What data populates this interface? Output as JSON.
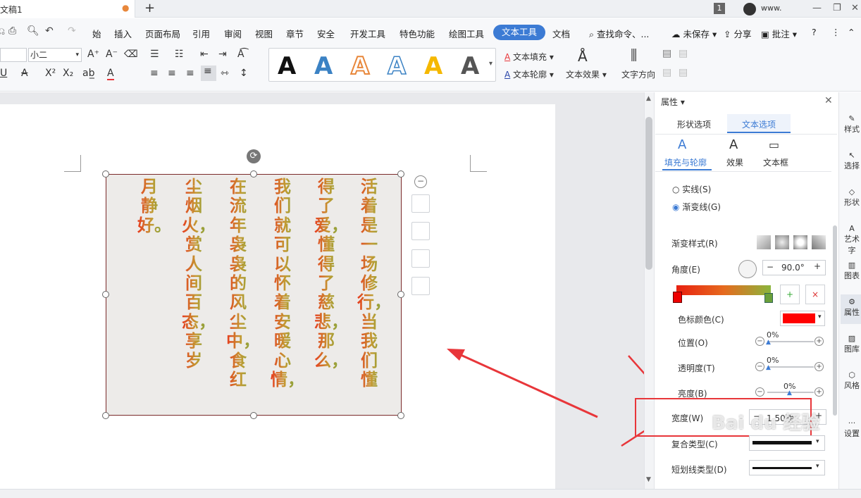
{
  "title_bar": {
    "doc_tab": "文稿1",
    "page_badge": "1",
    "user": "www."
  },
  "menu": {
    "items": [
      "插入",
      "页面布局",
      "引用",
      "审阅",
      "视图",
      "章节",
      "安全",
      "开发工具",
      "特色功能",
      "绘图工具"
    ],
    "active": "文本工具",
    "trailing": "文档",
    "search": "查找命令、...",
    "unsaved": "未保存",
    "share": "分享",
    "comment": "批注"
  },
  "toolbar": {
    "font_size": "小二",
    "text_fill": "文本填充",
    "text_outline": "文本轮廓",
    "text_effect": "文本效果",
    "text_direction": "文字方向",
    "style_colors": [
      "#111111",
      "#3b82c4",
      "#e8873b",
      "#3b82c4",
      "#f5b800",
      "#555555"
    ]
  },
  "document": {
    "columns": [
      "活着是一场修行，当我们懂",
      "得了爱，懂得了慈悲，那么，",
      "我们就可以怀着安暖心情，",
      "在流年袅袅的风尘中，食红",
      "尘烟火，赏人间百态，享岁",
      "月静好。"
    ]
  },
  "panel": {
    "title": "属性",
    "tabs": [
      "形状选项",
      "文本选项"
    ],
    "active_tab": "文本选项",
    "subtabs": [
      "填充与轮廓",
      "效果",
      "文本框"
    ],
    "line_solid": "实线(S)",
    "line_gradient": "渐变线(G)",
    "gradient_style": "渐变样式(R)",
    "angle_label": "角度(E)",
    "angle_value": "90.0°",
    "stop_color_label": "色标颜色(C)",
    "stop_color": "#ff0000",
    "position_label": "位置(O)",
    "position_value": "0%",
    "transparency_label": "透明度(T)",
    "transparency_value": "0%",
    "brightness_label": "亮度(B)",
    "brightness_value": "0%",
    "width_label": "宽度(W)",
    "width_value": "1.50磅",
    "compound_label": "复合类型(C)",
    "dash_label": "短划线类型(D)"
  },
  "rail": [
    "样式",
    "选择",
    "形状",
    "艺术字",
    "图表",
    "属性",
    "图库",
    "风格",
    "设置"
  ],
  "annotation_color": "#e8363a",
  "watermark": "Bai du 经验 jingyan.baidu.com"
}
